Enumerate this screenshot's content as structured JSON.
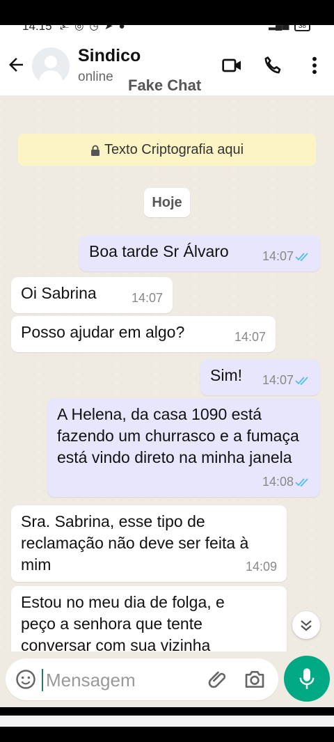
{
  "status_bar": {
    "time": "14:15",
    "notification_icons": "⍼ ◎ ◷ ➤ ●",
    "battery": "38"
  },
  "header": {
    "contact_name": "Sindico",
    "contact_status": "online",
    "watermark": "Fake Chat"
  },
  "encryption_banner": "Texto Criptografia aqui",
  "date_chip": "Hoje",
  "messages": [
    {
      "direction": "out",
      "text": "Boa tarde Sr Álvaro",
      "time": "14:07",
      "read": true
    },
    {
      "direction": "in",
      "text": "Oi Sabrina",
      "time": "14:07"
    },
    {
      "direction": "in",
      "text": "Posso ajudar em algo?",
      "time": "14:07"
    },
    {
      "direction": "out",
      "text": "Sim!",
      "time": "14:07",
      "read": true
    },
    {
      "direction": "out",
      "text": "A Helena, da casa 1090 está fazendo um churrasco e a fumaça está vindo direto na minha janela",
      "time": "14:08",
      "read": true
    },
    {
      "direction": "in",
      "text": "Sra. Sabrina, esse tipo de reclamação não deve ser feita à mim",
      "time": "14:09"
    },
    {
      "direction": "in",
      "text": "Estou no meu dia de folga, e peço a senhora que tente conversar com sua vizinha",
      "time": ""
    }
  ],
  "composer": {
    "placeholder": "Mensagem",
    "value": ""
  },
  "colors": {
    "accent": "#00a884",
    "chat_background": "#efeae2",
    "outgoing_bubble": "#e7e6fd",
    "incoming_bubble": "#ffffff",
    "banner": "#fdf4c5",
    "read_ticks": "#53bdeb"
  },
  "icons": [
    "back-arrow",
    "avatar",
    "video-call",
    "phone-call",
    "more-vertical",
    "lock",
    "double-check",
    "chevron-double-down",
    "emoji",
    "attach",
    "camera",
    "microphone"
  ]
}
